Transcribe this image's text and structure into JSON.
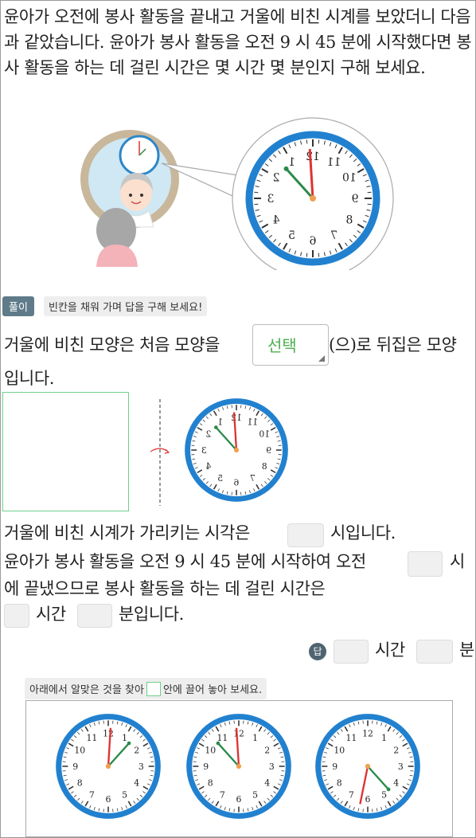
{
  "problem": {
    "text": "윤아가 오전에 봉사 활동을 끝내고 거울에 비친 시계를 보았더니 다음과 같았습니다. 윤아가 봉사 활동을 오전 9 시 45 분에 시작했다면 봉사 활동을 하는 데 걸린 시간은 몇 시간 몇 분인지 구해 보세요."
  },
  "illustration": {
    "mirror_clock": {
      "hour": 12,
      "minute": 7,
      "mirrored": true
    },
    "numbers": [
      "12",
      "1",
      "2",
      "3",
      "4",
      "5",
      "6",
      "7",
      "8",
      "9",
      "10",
      "11"
    ]
  },
  "solution": {
    "badge": "풀이",
    "hint": "빈칸을 채워 가며 답을 구해 보세요!",
    "line1_before": "거울에 비친 모양은 처음 모양을",
    "select_label": "선택",
    "line1_after": "(으)로 뒤집은 모양",
    "line1_end": "입니다.",
    "line2_before": "거울에 비친 시계가 가리키는 시각은",
    "line2_after": "시입니다.",
    "line3_before": "윤아가 봉사 활동을 오전 9 시 45 분에 시작하여 오전",
    "line3_after": "시",
    "line4": "에 끝냈으므로 봉사 활동을 하는 데 걸린 시간은",
    "line5_hours": "시간",
    "line5_minutes": "분입니다."
  },
  "answer": {
    "badge": "답",
    "hours_label": "시간",
    "minutes_label": "분"
  },
  "drag": {
    "hint_before": "아래에서 알맞은 것을 찾아",
    "hint_after": "안에 끌어 놓아 보세요."
  },
  "option_clocks": [
    {
      "hour": 12,
      "minute": 7
    },
    {
      "hour": 11,
      "minute": 53
    },
    {
      "hour": 6,
      "minute": 23
    }
  ]
}
